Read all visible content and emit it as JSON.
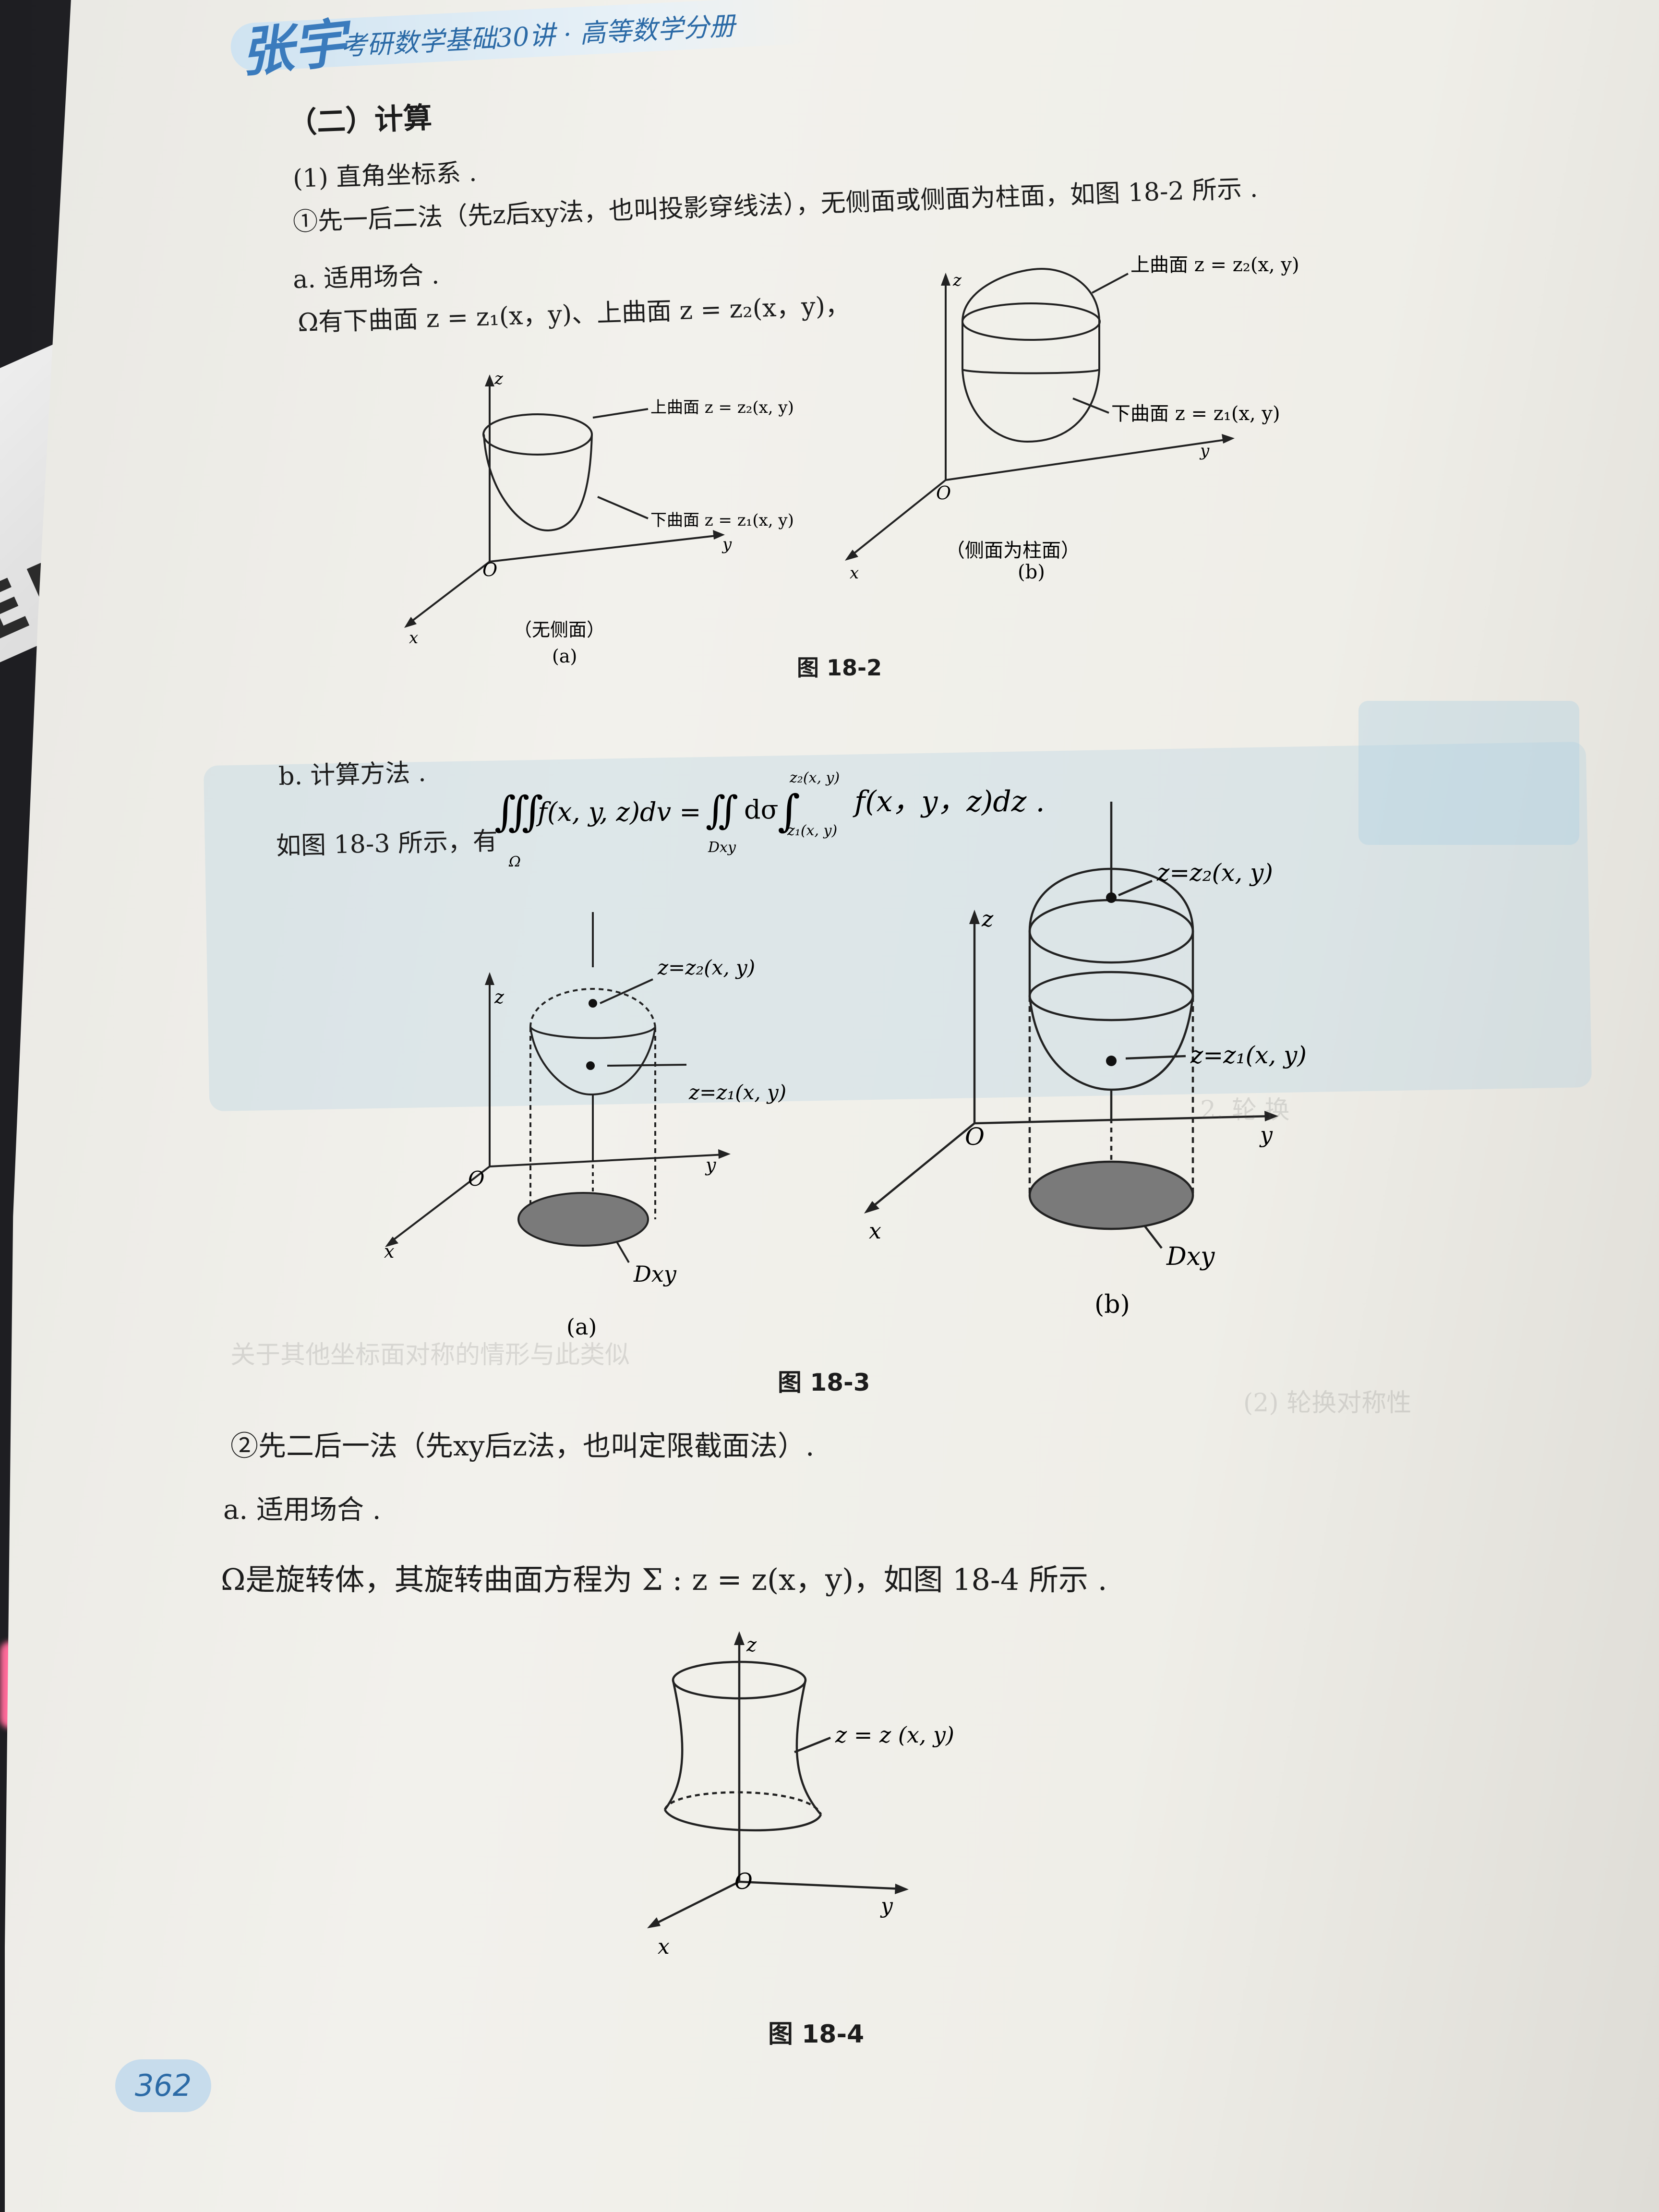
{
  "header": {
    "logo": "张宇",
    "title": "考研数学基础30讲 · 高等数学分册"
  },
  "section": {
    "heading": "（二）计算",
    "item1": "(1) 直角坐标系 .",
    "method1": "①先一后二法（先z后xy法，也叫投影穿线法），无侧面或侧面为柱面，如图 18-2 所示 .",
    "a_label": "a. 适用场合 .",
    "a_text": "Ω有下曲面 z = z₁(x，y)、上曲面 z = z₂(x，y)，",
    "b_label": "b. 计算方法 .",
    "b_text_prefix": "如图 18-3 所示，有",
    "b_formula": "∭ f(x, y, z)dv = ∬ dσ ∫ f(x，y，z)dz .",
    "b_formula_parts": {
      "triple_lower": "Ω",
      "double_lower": "Dxy",
      "int_upper": "z₂(x, y)",
      "int_lower": "z₁(x, y)",
      "integrand": "f(x，y，z)dz ."
    },
    "method2": "②先二后一法（先xy后z法，也叫定限截面法）.",
    "a2_label": "a. 适用场合 .",
    "a2_text": "Ω是旋转体，其旋转曲面方程为 Σ : z = z(x，y)，如图 18-4 所示 ."
  },
  "fig18_2": {
    "caption": "图 18-2",
    "a": {
      "upper": "上曲面 z = z₂(x, y)",
      "lower": "下曲面 z = z₁(x, y)",
      "note": "（无侧面）",
      "label": "(a)"
    },
    "b": {
      "upper": "上曲面 z = z₂(x, y)",
      "lower": "下曲面 z = z₁(x, y)",
      "note": "（侧面为柱面）",
      "label": "(b)"
    },
    "axes": {
      "x": "x",
      "y": "y",
      "z": "z",
      "o": "O"
    }
  },
  "fig18_3": {
    "caption": "图 18-3",
    "upper": "z=z₂(x, y)",
    "lower": "z=z₁(x, y)",
    "region": "Dxy",
    "label_a": "(a)",
    "label_b": "(b)"
  },
  "fig18_4": {
    "caption": "图 18-4",
    "surface": "z = z (x, y)"
  },
  "page_number": "362",
  "background_device_text": "ENNIU",
  "colors": {
    "accent": "#2b6aa6",
    "band": "#cfe3f1"
  }
}
